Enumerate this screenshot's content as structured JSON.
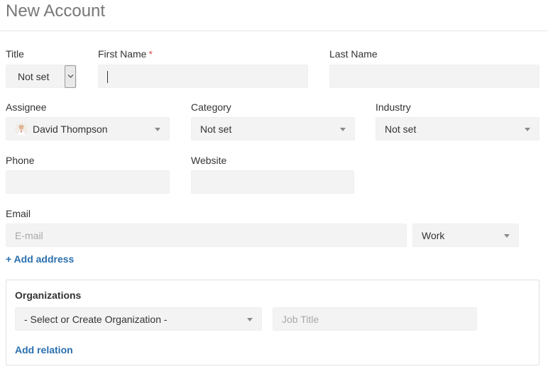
{
  "page": {
    "title": "New Account"
  },
  "fields": {
    "title": {
      "label": "Title",
      "value": "Not set"
    },
    "first_name": {
      "label": "First Name",
      "required_mark": "*",
      "value": ""
    },
    "last_name": {
      "label": "Last Name",
      "value": ""
    },
    "assignee": {
      "label": "Assignee",
      "value": "David Thompson"
    },
    "category": {
      "label": "Category",
      "value": "Not set"
    },
    "industry": {
      "label": "Industry",
      "value": "Not set"
    },
    "phone": {
      "label": "Phone",
      "value": ""
    },
    "website": {
      "label": "Website",
      "value": ""
    },
    "email": {
      "label": "Email",
      "placeholder": "E-mail",
      "type_value": "Work"
    }
  },
  "links": {
    "add_address": "+ Add address",
    "add_relation": "Add relation"
  },
  "organizations": {
    "title": "Organizations",
    "select_placeholder": "- Select or Create Organization -",
    "job_title_placeholder": "Job Title"
  },
  "colors": {
    "link": "#2a6fae",
    "required": "#d9534f",
    "field_bg": "#f3f3f3"
  }
}
